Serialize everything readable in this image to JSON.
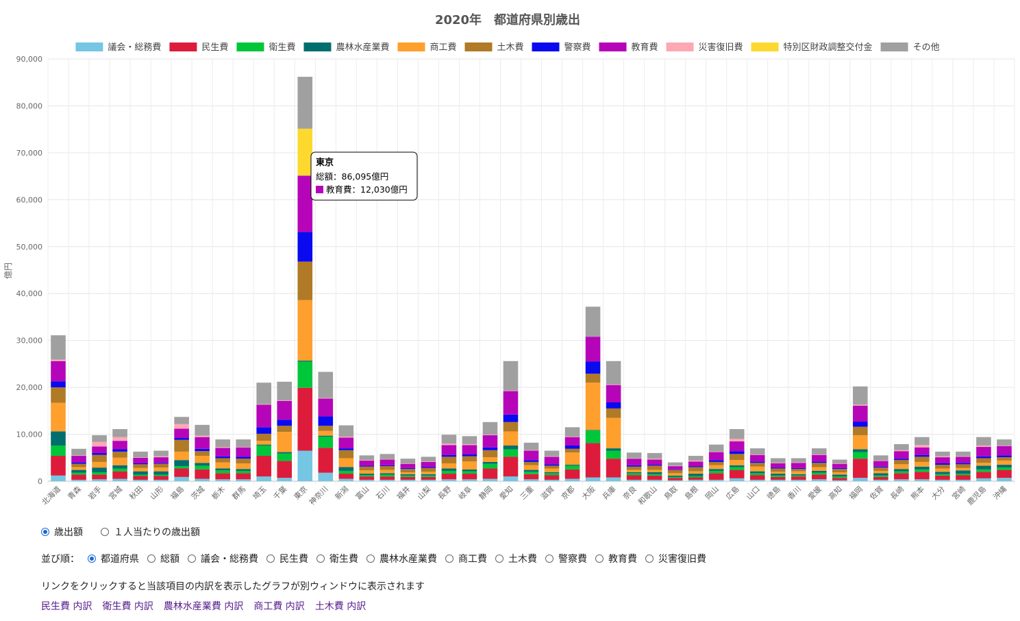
{
  "chart_data": {
    "type": "bar",
    "stacked": true,
    "title": "2020年　都道府県別歳出",
    "ylabel": "億円",
    "ylim": [
      0,
      90000
    ],
    "yticks": [
      "0",
      "10,000",
      "20,000",
      "30,000",
      "40,000",
      "50,000",
      "60,000",
      "70,000",
      "80,000",
      "90,000"
    ],
    "grid": true,
    "legend_position": "top",
    "categories": [
      "北海道",
      "青森",
      "岩手",
      "宮城",
      "秋田",
      "山形",
      "福島",
      "茨城",
      "栃木",
      "群馬",
      "埼玉",
      "千葉",
      "東京",
      "神奈川",
      "新潟",
      "富山",
      "石川",
      "福井",
      "山梨",
      "長野",
      "岐阜",
      "静岡",
      "愛知",
      "三重",
      "滋賀",
      "京都",
      "大阪",
      "兵庫",
      "奈良",
      "和歌山",
      "鳥取",
      "島根",
      "岡山",
      "広島",
      "山口",
      "徳島",
      "香川",
      "愛媛",
      "高知",
      "福岡",
      "佐賀",
      "長崎",
      "熊本",
      "大分",
      "宮崎",
      "鹿児島",
      "沖縄"
    ],
    "series": [
      {
        "name": "議会・総務費",
        "color": "#74c6e3",
        "values": [
          1200,
          300,
          400,
          500,
          300,
          300,
          900,
          500,
          400,
          400,
          1000,
          700,
          6500,
          1800,
          500,
          300,
          300,
          300,
          300,
          400,
          400,
          500,
          1000,
          400,
          300,
          500,
          800,
          800,
          300,
          300,
          200,
          300,
          300,
          600,
          300,
          300,
          300,
          400,
          200,
          700,
          300,
          400,
          400,
          300,
          300,
          600,
          700
        ]
      },
      {
        "name": "民生費",
        "color": "#dd1c3b",
        "values": [
          4200,
          1100,
          1000,
          1600,
          800,
          800,
          1800,
          2000,
          1300,
          1300,
          4400,
          3600,
          13400,
          5300,
          1100,
          700,
          700,
          600,
          600,
          1200,
          1200,
          2200,
          4200,
          1100,
          1000,
          2000,
          7300,
          4000,
          1000,
          900,
          500,
          500,
          1400,
          1800,
          1000,
          600,
          700,
          1000,
          500,
          4100,
          600,
          1300,
          1600,
          900,
          1000,
          1400,
          1700
        ]
      },
      {
        "name": "衛生費",
        "color": "#00c63a",
        "values": [
          2200,
          400,
          500,
          600,
          300,
          300,
          500,
          800,
          600,
          500,
          2200,
          1600,
          5600,
          2400,
          600,
          300,
          400,
          300,
          300,
          600,
          500,
          1000,
          1600,
          500,
          400,
          800,
          2700,
          1700,
          400,
          300,
          200,
          300,
          500,
          600,
          400,
          300,
          200,
          400,
          300,
          1400,
          300,
          400,
          500,
          300,
          300,
          500,
          500
        ]
      },
      {
        "name": "農林水産業費",
        "color": "#006e6e",
        "values": [
          3000,
          600,
          1000,
          700,
          700,
          700,
          1300,
          600,
          400,
          400,
          200,
          300,
          200,
          200,
          800,
          300,
          300,
          300,
          300,
          500,
          400,
          400,
          800,
          400,
          200,
          200,
          100,
          500,
          200,
          400,
          300,
          500,
          400,
          400,
          400,
          400,
          300,
          400,
          400,
          600,
          500,
          500,
          600,
          500,
          700,
          800,
          600
        ]
      },
      {
        "name": "商工費",
        "color": "#ff9f2e",
        "values": [
          6100,
          600,
          1200,
          1600,
          700,
          800,
          1800,
          1500,
          1300,
          1200,
          800,
          4300,
          12900,
          1000,
          1900,
          700,
          700,
          400,
          500,
          1100,
          1700,
          1000,
          3000,
          1000,
          800,
          2600,
          10100,
          6500,
          500,
          500,
          500,
          500,
          800,
          1100,
          1000,
          400,
          600,
          800,
          500,
          3000,
          500,
          1000,
          1000,
          700,
          500,
          600,
          900
        ]
      },
      {
        "name": "土木費",
        "color": "#b07a26",
        "values": [
          3300,
          700,
          1500,
          1300,
          800,
          800,
          2500,
          1000,
          900,
          1000,
          1500,
          1300,
          8200,
          1100,
          1700,
          800,
          800,
          700,
          800,
          1400,
          1100,
          1500,
          2000,
          700,
          600,
          800,
          1900,
          2000,
          700,
          900,
          700,
          900,
          700,
          1300,
          800,
          700,
          500,
          900,
          700,
          1800,
          700,
          900,
          1100,
          800,
          800,
          1000,
          700
        ]
      },
      {
        "name": "警察費",
        "color": "#0a0af0",
        "values": [
          1300,
          300,
          400,
          500,
          200,
          200,
          400,
          500,
          400,
          400,
          1400,
          1300,
          6300,
          2000,
          400,
          200,
          200,
          200,
          200,
          400,
          400,
          600,
          1600,
          400,
          300,
          700,
          2600,
          1300,
          300,
          200,
          100,
          200,
          400,
          600,
          300,
          200,
          200,
          300,
          200,
          1100,
          200,
          300,
          400,
          300,
          300,
          400,
          400
        ]
      },
      {
        "name": "教育費",
        "color": "#b605b9",
        "values": [
          4300,
          1400,
          1400,
          1800,
          1200,
          1200,
          2000,
          2500,
          1800,
          2000,
          4800,
          4000,
          12030,
          3800,
          2300,
          1100,
          1200,
          900,
          1100,
          2100,
          2000,
          2600,
          5000,
          2000,
          1600,
          1800,
          5300,
          3700,
          1400,
          1100,
          700,
          1000,
          1700,
          2100,
          1400,
          900,
          1100,
          1400,
          900,
          3400,
          1200,
          1600,
          1600,
          1300,
          1300,
          2000,
          2000
        ]
      },
      {
        "name": "災害復旧費",
        "color": "#fca9b4",
        "values": [
          300,
          100,
          1000,
          800,
          100,
          200,
          1000,
          300,
          200,
          100,
          100,
          100,
          0,
          100,
          200,
          100,
          100,
          100,
          100,
          300,
          200,
          100,
          100,
          100,
          100,
          100,
          0,
          100,
          100,
          200,
          100,
          200,
          100,
          500,
          100,
          100,
          100,
          100,
          100,
          200,
          100,
          200,
          500,
          200,
          100,
          300,
          100
        ]
      },
      {
        "name": "特別区財政調整交付金",
        "color": "#fdd92f",
        "values": [
          0,
          0,
          0,
          0,
          0,
          0,
          0,
          0,
          0,
          0,
          0,
          0,
          10000,
          0,
          0,
          0,
          0,
          0,
          0,
          0,
          0,
          0,
          0,
          0,
          0,
          0,
          0,
          0,
          0,
          0,
          0,
          0,
          0,
          0,
          0,
          0,
          0,
          0,
          0,
          0,
          0,
          0,
          0,
          0,
          0,
          0,
          0
        ]
      },
      {
        "name": "その他",
        "color": "#a0a0a0",
        "values": [
          5200,
          1400,
          1400,
          1700,
          1200,
          1200,
          1500,
          2300,
          1600,
          1600,
          4600,
          4000,
          11065,
          5600,
          2400,
          1000,
          1100,
          1000,
          1000,
          1900,
          1700,
          2700,
          6300,
          1600,
          1200,
          2000,
          6400,
          5000,
          1200,
          1200,
          700,
          1000,
          1500,
          2100,
          1300,
          1000,
          900,
          1300,
          800,
          3900,
          1100,
          1300,
          1700,
          1000,
          1000,
          1800,
          1300
        ]
      }
    ],
    "tooltip": {
      "title": "東京",
      "total_text": "総額：86,095億円",
      "item_text": "教育費：12,030億円",
      "item_color": "#b605b9",
      "category": "東京",
      "series": "教育費"
    }
  },
  "controls": {
    "mode_options": [
      {
        "label": "歳出額",
        "checked": true
      },
      {
        "label": "１人当たりの歳出額",
        "checked": false
      }
    ],
    "sort_label": "並び順：",
    "sort_options": [
      {
        "label": "都道府県",
        "checked": true
      },
      {
        "label": "総額",
        "checked": false
      },
      {
        "label": "議会・総務費",
        "checked": false
      },
      {
        "label": "民生費",
        "checked": false
      },
      {
        "label": "衛生費",
        "checked": false
      },
      {
        "label": "農林水産業費",
        "checked": false
      },
      {
        "label": "商工費",
        "checked": false
      },
      {
        "label": "土木費",
        "checked": false
      },
      {
        "label": "警察費",
        "checked": false
      },
      {
        "label": "教育費",
        "checked": false
      },
      {
        "label": "災害復旧費",
        "checked": false
      }
    ],
    "note": "リンクをクリックすると当該項目の内訳を表示したグラフが別ウィンドウに表示されます",
    "links": [
      "民生費 内訳",
      "衛生費 内訳",
      "農林水産業費 内訳",
      "商工費 内訳",
      "土木費 内訳"
    ]
  }
}
